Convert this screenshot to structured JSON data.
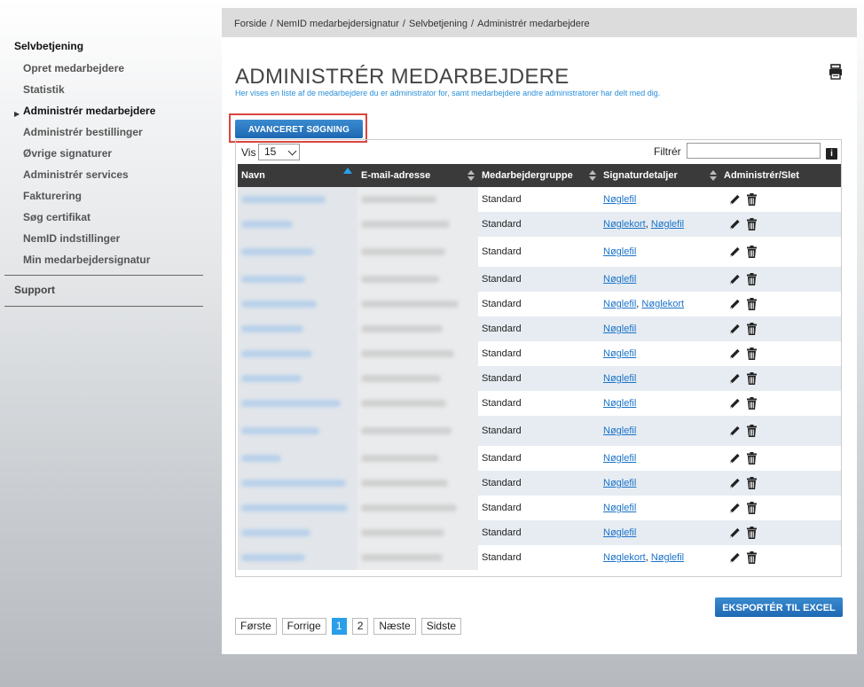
{
  "sidebar": {
    "heading": "Selvbetjening",
    "items": [
      {
        "label": "Opret medarbejdere"
      },
      {
        "label": "Statistik"
      },
      {
        "label": "Administrér medarbejdere"
      },
      {
        "label": "Administrér bestillinger"
      },
      {
        "label": "Øvrige signaturer"
      },
      {
        "label": "Administrér services"
      },
      {
        "label": "Fakturering"
      },
      {
        "label": "Søg certifikat"
      },
      {
        "label": "NemID indstillinger"
      },
      {
        "label": "Min medarbejdersignatur"
      }
    ],
    "active_index": 2,
    "support": "Support"
  },
  "breadcrumb": [
    "Forside",
    "NemID medarbejdersignatur",
    "Selvbetjening",
    "Administrér medarbejdere"
  ],
  "page": {
    "title": "ADMINISTRÉR MEDARBEJDERE",
    "subtitle": "Her vises en liste af de medarbejdere du er administrator for, samt medarbejdere andre administratorer har delt med dig.",
    "advanced_search": "AVANCERET SØGNING",
    "export": "EKSPORTÉR TIL EXCEL"
  },
  "table_controls": {
    "vis_label": "Vis",
    "vis_value": "15",
    "filter_label": "Filtrér",
    "filter_value": ""
  },
  "table": {
    "columns": [
      "Navn",
      "E-mail-adresse",
      "Medarbejdergruppe",
      "Signaturdetaljer",
      "Administrér/Slet"
    ],
    "rows": [
      {
        "group": "Standard",
        "sig": [
          "Nøglefil"
        ]
      },
      {
        "group": "Standard",
        "sig": [
          "Nøglekort",
          "Nøglefil"
        ]
      },
      {
        "group": "Standard",
        "sig": [
          "Nøglefil"
        ]
      },
      {
        "group": "Standard",
        "sig": [
          "Nøglefil"
        ]
      },
      {
        "group": "Standard",
        "sig": [
          "Nøglefil",
          "Nøglekort"
        ]
      },
      {
        "group": "Standard",
        "sig": [
          "Nøglefil"
        ]
      },
      {
        "group": "Standard",
        "sig": [
          "Nøglefil"
        ]
      },
      {
        "group": "Standard",
        "sig": [
          "Nøglefil"
        ]
      },
      {
        "group": "Standard",
        "sig": [
          "Nøglefil"
        ]
      },
      {
        "group": "Standard",
        "sig": [
          "Nøglefil"
        ]
      },
      {
        "group": "Standard",
        "sig": [
          "Nøglefil"
        ]
      },
      {
        "group": "Standard",
        "sig": [
          "Nøglefil"
        ]
      },
      {
        "group": "Standard",
        "sig": [
          "Nøglefil"
        ]
      },
      {
        "group": "Standard",
        "sig": [
          "Nøglefil"
        ]
      },
      {
        "group": "Standard",
        "sig": [
          "Nøglekort",
          "Nøglefil"
        ]
      }
    ]
  },
  "pager": {
    "first": "Første",
    "prev": "Forrige",
    "pages": [
      "1",
      "2"
    ],
    "current": "1",
    "next": "Næste",
    "last": "Sidste"
  },
  "colors": {
    "accent": "#2a9ee8",
    "button": "#1e68b3",
    "header_bg": "#3a3a3a",
    "highlight": "#d9463f"
  },
  "icons": [
    "print-icon",
    "info-icon",
    "pencil-icon",
    "trash-icon",
    "sort-icon",
    "arrow-right-icon"
  ]
}
